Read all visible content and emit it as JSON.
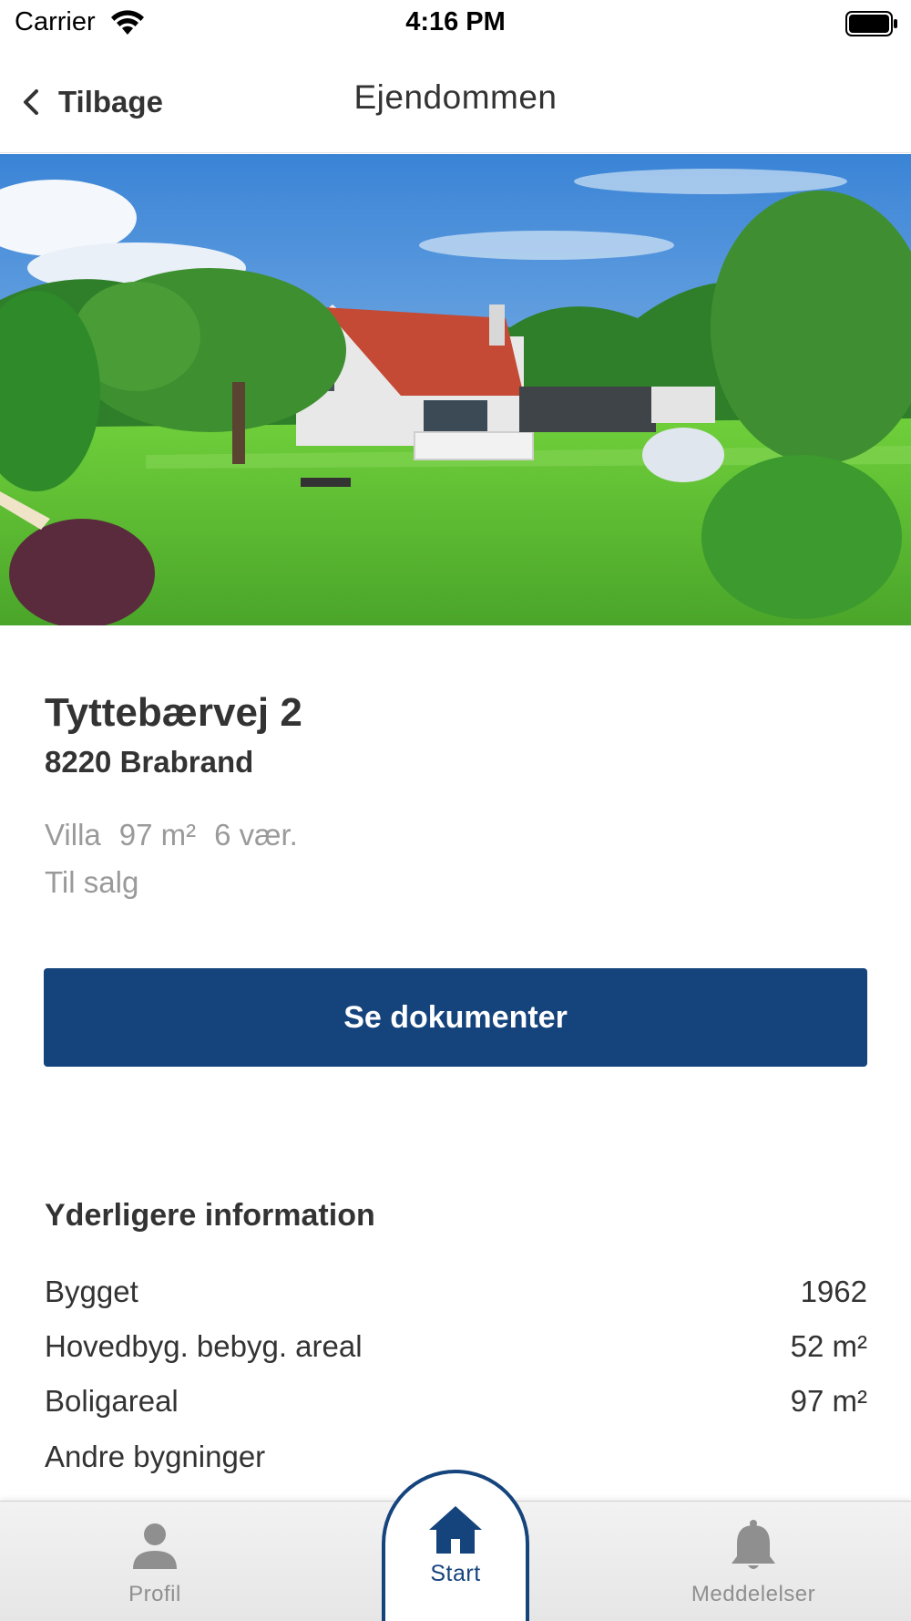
{
  "status_bar": {
    "carrier": "Carrier",
    "time": "4:16 PM",
    "icons": [
      "wifi-icon",
      "battery-icon"
    ]
  },
  "nav": {
    "back_label": "Tilbage",
    "title": "Ejendommen"
  },
  "hero": {
    "image": "house-photo"
  },
  "property": {
    "address": "Tyttebærvej 2",
    "postal": "8220 Brabrand",
    "type": "Villa",
    "area": "97 m²",
    "rooms": "6 vær.",
    "status": "Til salg"
  },
  "actions": {
    "documents_label": "Se dokumenter"
  },
  "info": {
    "heading": "Yderligere information",
    "rows": [
      {
        "label": "Bygget",
        "value": "1962"
      },
      {
        "label": "Hovedbyg. bebyg. areal",
        "value": "52 m²"
      },
      {
        "label": "Boligareal",
        "value": "97 m²"
      },
      {
        "label": "Andre bygninger",
        "value": ""
      }
    ]
  },
  "tabs": {
    "profile": "Profil",
    "start": "Start",
    "notifications": "Meddelelser",
    "icons": [
      "person-icon",
      "home-icon",
      "bell-icon"
    ]
  },
  "colors": {
    "primary": "#15447d",
    "text": "#333333",
    "muted": "#9a9a9a"
  }
}
